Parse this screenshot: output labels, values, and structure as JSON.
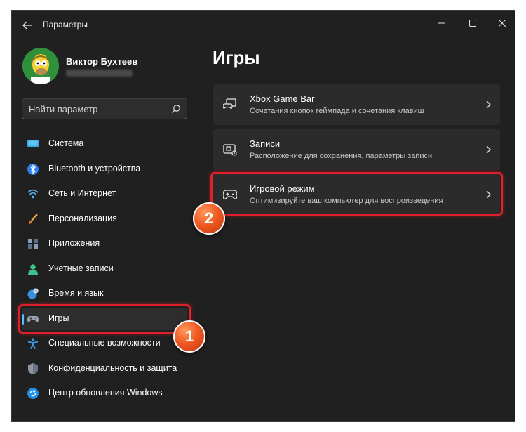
{
  "window": {
    "title": "Параметры"
  },
  "user": {
    "name": "Виктор Бухтеев"
  },
  "search": {
    "placeholder": "Найти параметр"
  },
  "sidebar": {
    "items": [
      {
        "label": "Система",
        "icon": "monitor-icon"
      },
      {
        "label": "Bluetooth и устройства",
        "icon": "bluetooth-icon"
      },
      {
        "label": "Сеть и Интернет",
        "icon": "wifi-icon"
      },
      {
        "label": "Персонализация",
        "icon": "brush-icon"
      },
      {
        "label": "Приложения",
        "icon": "apps-icon"
      },
      {
        "label": "Учетные записи",
        "icon": "person-icon"
      },
      {
        "label": "Время и язык",
        "icon": "globe-clock-icon"
      },
      {
        "label": "Игры",
        "icon": "gamepad-icon",
        "active": true
      },
      {
        "label": "Специальные возможности",
        "icon": "accessibility-icon"
      },
      {
        "label": "Конфиденциальность и защита",
        "icon": "shield-icon"
      },
      {
        "label": "Центр обновления Windows",
        "icon": "update-icon"
      }
    ]
  },
  "main": {
    "title": "Игры",
    "cards": [
      {
        "title": "Xbox Game Bar",
        "subtitle": "Сочетания кнопок геймпада и сочетания клавиш",
        "icon": "game-bar-icon"
      },
      {
        "title": "Записи",
        "subtitle": "Расположение для сохранения, параметры записи",
        "icon": "capture-icon"
      },
      {
        "title": "Игровой режим",
        "subtitle": "Оптимизируйте ваш компьютер для воспроизведения",
        "icon": "gamepad-icon"
      }
    ]
  },
  "annotations": {
    "badge1": "1",
    "badge2": "2"
  },
  "colors": {
    "accent": "#4cc2ff",
    "highlight": "#e0202a",
    "badge": "#f05a24",
    "background": "#202020",
    "card": "#2b2b2b"
  }
}
